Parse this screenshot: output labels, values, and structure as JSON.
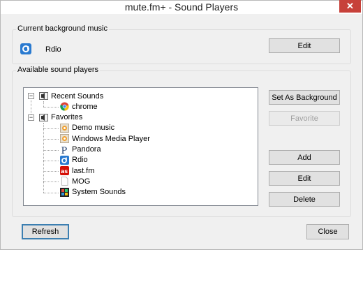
{
  "window": {
    "title": "mute.fm+ - Sound Players",
    "close_glyph": "✕"
  },
  "current": {
    "legend": "Current background music",
    "player_icon": "rdio-icon",
    "player_name": "Rdio",
    "edit_label": "Edit"
  },
  "available": {
    "legend": "Available sound players",
    "tree": [
      {
        "label": "Recent Sounds",
        "icon": "speaker-group-icon",
        "level": 0,
        "expanded": true,
        "expander": "−"
      },
      {
        "label": "chrome",
        "icon": "chrome-icon",
        "level": 1
      },
      {
        "label": "Favorites",
        "icon": "speaker-group-icon",
        "level": 0,
        "expanded": true,
        "expander": "−"
      },
      {
        "label": "Demo music",
        "icon": "speaker-icon",
        "level": 1
      },
      {
        "label": "Windows Media Player",
        "icon": "speaker-icon",
        "level": 1
      },
      {
        "label": "Pandora",
        "icon": "pandora-icon",
        "level": 1
      },
      {
        "label": "Rdio",
        "icon": "rdio-icon",
        "level": 1
      },
      {
        "label": "last.fm",
        "icon": "lastfm-icon",
        "level": 1
      },
      {
        "label": "MOG",
        "icon": "blank-page-icon",
        "level": 1
      },
      {
        "label": "System Sounds",
        "icon": "windows-icon",
        "level": 1
      }
    ],
    "buttons": {
      "set_background": "Set As Background",
      "favorite": "Favorite",
      "add": "Add",
      "edit": "Edit",
      "delete": "Delete"
    }
  },
  "footer": {
    "refresh": "Refresh",
    "close": "Close"
  },
  "colors": {
    "rdio_blue": "#2a7ad0",
    "lastfm_red": "#d51007",
    "close_red": "#c7413a"
  }
}
